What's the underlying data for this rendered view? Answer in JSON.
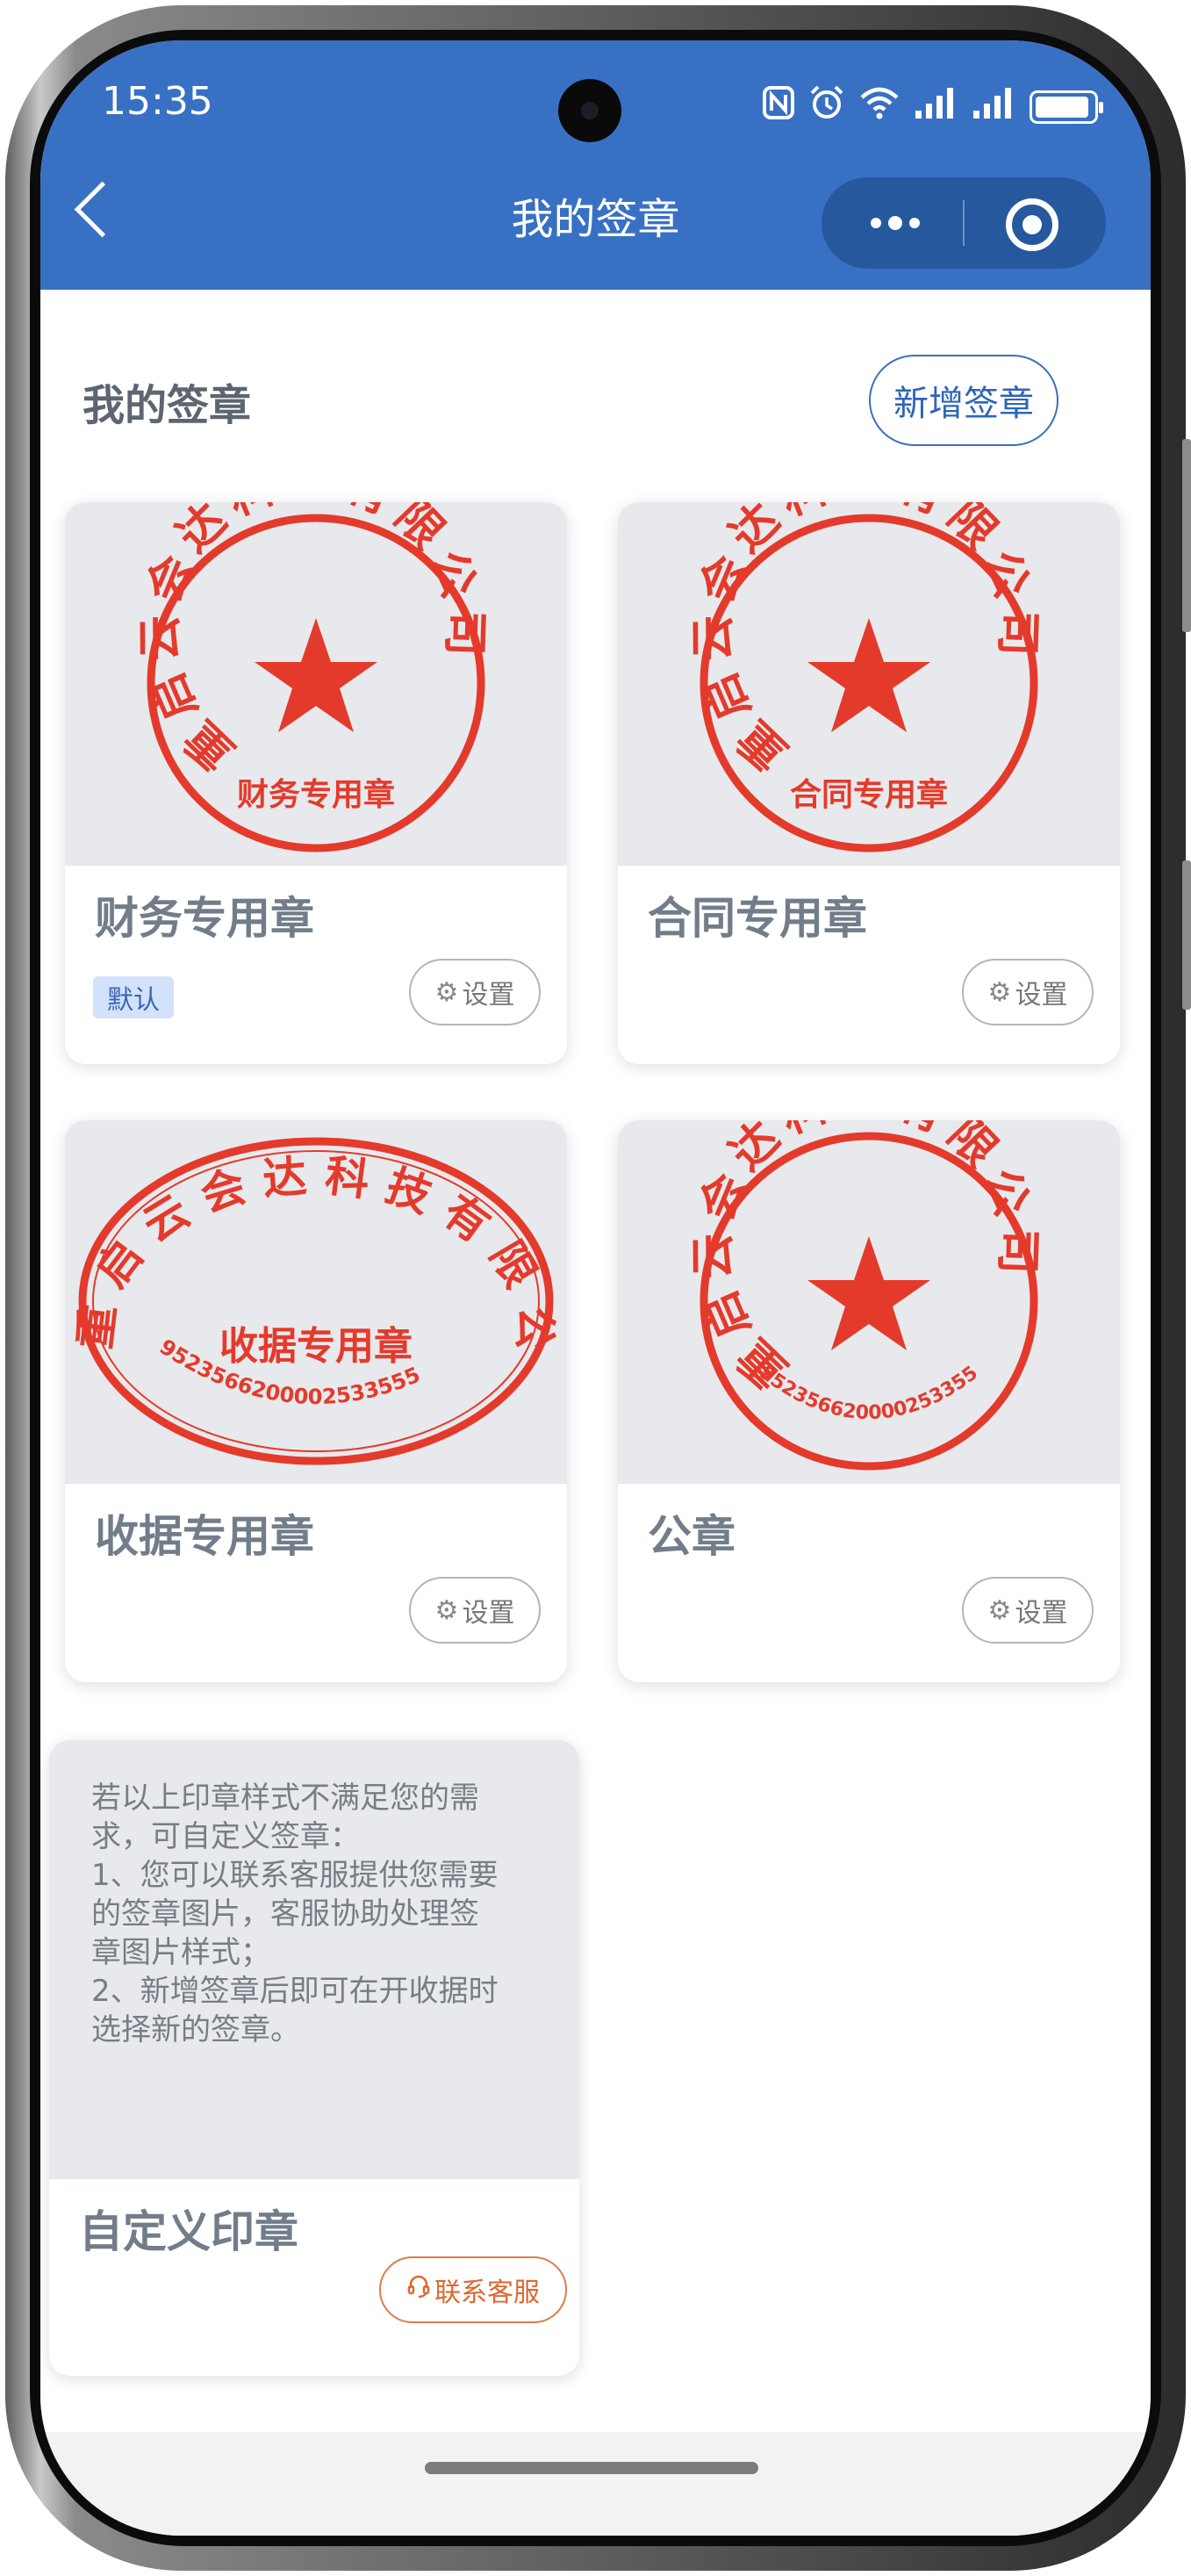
{
  "status_bar": {
    "time": "15:35"
  },
  "header": {
    "title": "我的签章"
  },
  "main": {
    "section_title": "我的签章",
    "add_button": "新增签章",
    "seals": [
      {
        "name": "财务专用章",
        "badge": "默认",
        "setting": "设置",
        "seal_company": "重启云会达科技有限公司",
        "seal_caption": "财务专用章",
        "seal_shape": "circle-star"
      },
      {
        "name": "合同专用章",
        "setting": "设置",
        "seal_company": "重启云会达科技有限公司",
        "seal_caption": "合同专用章",
        "seal_shape": "circle-star"
      },
      {
        "name": "收据专用章",
        "setting": "设置",
        "seal_company": "重启云会达科技有限公司",
        "seal_caption": "收据专用章",
        "seal_number": "9523566200002533555",
        "seal_shape": "ellipse"
      },
      {
        "name": "公章",
        "setting": "设置",
        "seal_company": "重启云会达科技有限公司",
        "seal_number": "9523566200002533555",
        "seal_shape": "circle-star"
      }
    ],
    "custom": {
      "description": [
        "若以上印章样式不满足您的需",
        "求，可自定义签章：",
        "1、您可以联系客服提供您需要",
        "的签章图片，客服协助处理签",
        "章图片样式；",
        "2、新增签章后即可在开收据时",
        "选择新的签章。"
      ],
      "name": "自定义印章",
      "contact_button": "联系客服"
    }
  },
  "colors": {
    "header": "#3870c4",
    "seal_red": "#e43a2c",
    "accent_blue": "#2e64b8",
    "contact_orange": "#e0672e"
  }
}
